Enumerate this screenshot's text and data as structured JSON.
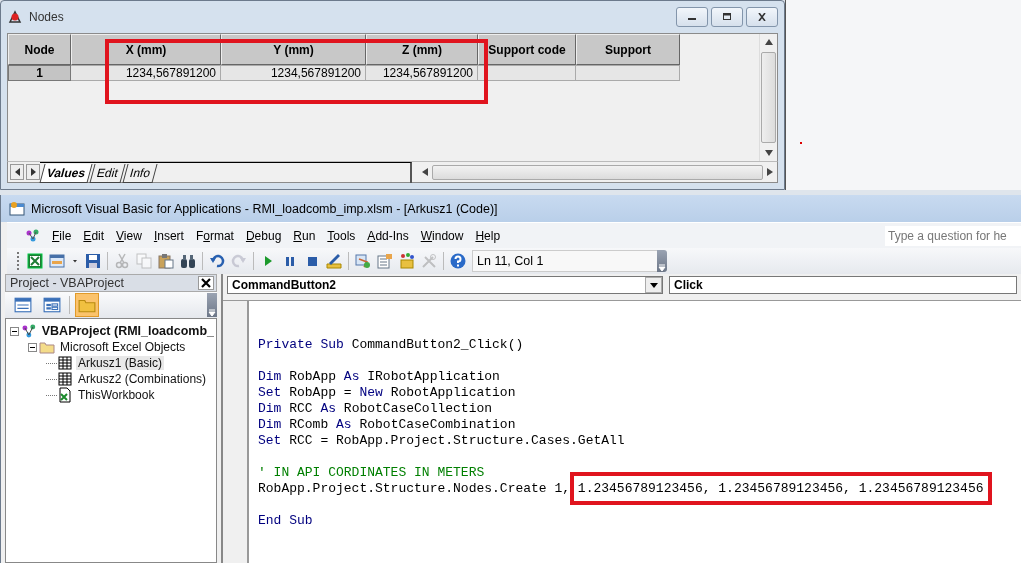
{
  "nodes_window": {
    "title": "Nodes",
    "table": {
      "columns": [
        {
          "label": "Node"
        },
        {
          "label": "X (mm)",
          "highlighted": true
        },
        {
          "label": "Y (mm)",
          "highlighted": true
        },
        {
          "label": "Z (mm)",
          "highlighted": true
        },
        {
          "label": "Support code"
        },
        {
          "label": "Support"
        }
      ],
      "rows": [
        {
          "cells": [
            "1",
            "1234,567891200",
            "1234,567891200",
            "1234,567891200"
          ]
        }
      ]
    },
    "tabs": [
      {
        "label": "Values",
        "selected": true
      },
      {
        "label": "Edit",
        "selected": false
      },
      {
        "label": "Info",
        "selected": false
      }
    ]
  },
  "vba_window": {
    "title": "Microsoft Visual Basic for Applications - RMI_loadcomb_imp.xlsm - [Arkusz1 (Code)]",
    "menu": [
      {
        "key": "F",
        "post": "ile"
      },
      {
        "key": "E",
        "post": "dit"
      },
      {
        "key": "V",
        "post": "iew"
      },
      {
        "key": "I",
        "post": "nsert"
      },
      {
        "pre": "F",
        "key": "o",
        "post": "rmat"
      },
      {
        "key": "D",
        "post": "ebug"
      },
      {
        "key": "R",
        "post": "un"
      },
      {
        "key": "T",
        "post": "ools"
      },
      {
        "key": "A",
        "post": "dd-Ins"
      },
      {
        "key": "W",
        "post": "indow"
      },
      {
        "key": "H",
        "post": "elp"
      }
    ],
    "help_search": {
      "placeholder": "Type a question for he"
    },
    "toolbar": [
      {
        "kind": "excel",
        "disabled": false
      },
      {
        "kind": "userform",
        "disabled": false
      },
      {
        "kind": "caret",
        "disabled": false
      },
      {
        "kind": "save",
        "disabled": false
      },
      {
        "kind": "separator"
      },
      {
        "kind": "cut",
        "disabled": true
      },
      {
        "kind": "copy",
        "disabled": true
      },
      {
        "kind": "paste",
        "disabled": false
      },
      {
        "kind": "find",
        "disabled": false
      },
      {
        "kind": "separator"
      },
      {
        "kind": "undo",
        "disabled": false
      },
      {
        "kind": "redo",
        "disabled": true
      },
      {
        "kind": "separator"
      },
      {
        "kind": "run",
        "disabled": false
      },
      {
        "kind": "pause",
        "disabled": false
      },
      {
        "kind": "stop",
        "disabled": false
      },
      {
        "kind": "design",
        "disabled": false
      },
      {
        "kind": "separator"
      },
      {
        "kind": "explorer",
        "disabled": false
      },
      {
        "kind": "properties",
        "disabled": false
      },
      {
        "kind": "browser",
        "disabled": false
      },
      {
        "kind": "toolbox",
        "disabled": true
      },
      {
        "kind": "separator"
      },
      {
        "kind": "help",
        "disabled": false
      }
    ],
    "position": "Ln 11, Col 1",
    "project": {
      "title": "Project - VBAProject",
      "view_buttons": [
        {
          "kind": "view-code",
          "selected": false
        },
        {
          "kind": "view-object",
          "selected": false
        },
        {
          "kind": "toggle-folders",
          "selected": true
        }
      ],
      "tree": [
        {
          "label": "VBAProject (RMI_loadcomb_",
          "kind": "project",
          "expanded": true,
          "selected": false,
          "children": [
            {
              "label": "Microsoft Excel Objects",
              "kind": "folder",
              "expanded": true,
              "selected": false,
              "children": [
                {
                  "label": "Arkusz1 (Basic)",
                  "kind": "sheet",
                  "selected": true
                },
                {
                  "label": "Arkusz2 (Combinations)",
                  "kind": "sheet",
                  "selected": false
                },
                {
                  "label": "ThisWorkbook",
                  "kind": "workbook",
                  "selected": false
                }
              ]
            }
          ]
        }
      ]
    },
    "code": {
      "object": "CommandButton2",
      "procedure": "Click",
      "blocks": [
        [
          [
            {
              "kind": "keyword",
              "text": "Private Sub"
            },
            {
              "kind": "plain",
              "text": " CommandButton2_Click()"
            }
          ]
        ],
        [
          [
            {
              "kind": "keyword",
              "text": "Dim"
            },
            {
              "kind": "plain",
              "text": " RobApp "
            },
            {
              "kind": "keyword",
              "text": "As"
            },
            {
              "kind": "plain",
              "text": " IRobotApplication"
            }
          ],
          [
            {
              "kind": "keyword",
              "text": "Set"
            },
            {
              "kind": "plain",
              "text": " RobApp = "
            },
            {
              "kind": "keyword",
              "text": "New"
            },
            {
              "kind": "plain",
              "text": " RobotApplication"
            }
          ],
          [
            {
              "kind": "keyword",
              "text": "Dim"
            },
            {
              "kind": "plain",
              "text": " RCC "
            },
            {
              "kind": "keyword",
              "text": "As"
            },
            {
              "kind": "plain",
              "text": " RobotCaseCollection"
            }
          ],
          [
            {
              "kind": "keyword",
              "text": "Dim"
            },
            {
              "kind": "plain",
              "text": " RComb "
            },
            {
              "kind": "keyword",
              "text": "As"
            },
            {
              "kind": "plain",
              "text": " RobotCaseCombination"
            }
          ],
          [
            {
              "kind": "keyword",
              "text": "Set"
            },
            {
              "kind": "plain",
              "text": " RCC = RobApp.Project.Structure.Cases.GetAll"
            }
          ]
        ],
        [
          [
            {
              "kind": "comment",
              "text": "' IN API CORDINATES IN METERS"
            }
          ],
          [
            {
              "kind": "plain",
              "text": "RobApp.Project.Structure.Nodes.Create 1, "
            },
            {
              "kind": "plain",
              "text": "1.23456789123456, 1.23456789123456, 1.23456789123456",
              "highlighted": true
            }
          ]
        ],
        [
          [
            {
              "kind": "keyword",
              "text": "End Sub"
            }
          ]
        ]
      ]
    }
  }
}
